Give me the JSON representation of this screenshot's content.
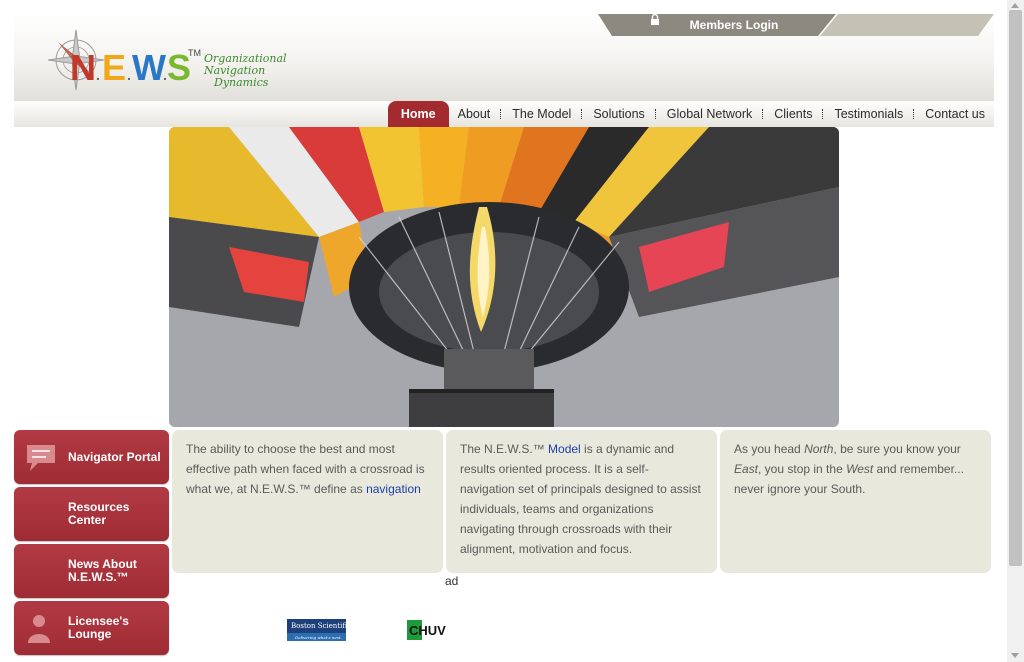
{
  "header": {
    "logo_main": "N.E.W.S",
    "logo_tm": "TM",
    "logo_tagline": [
      "Organizational",
      "Navigation",
      "Dynamics"
    ],
    "members_login": "Members Login"
  },
  "nav": {
    "items": [
      {
        "label": "Home",
        "active": true
      },
      {
        "label": "About"
      },
      {
        "label": "The Model"
      },
      {
        "label": "Solutions"
      },
      {
        "label": "Global Network"
      },
      {
        "label": "Clients"
      },
      {
        "label": "Testimonials"
      },
      {
        "label": "Contact us"
      }
    ]
  },
  "sidebar": {
    "items": [
      {
        "label": "Navigator Portal",
        "icon": "speech-bubble-icon"
      },
      {
        "label": "Resources Center",
        "icon": ""
      },
      {
        "label": "News About N.E.W.S.™",
        "icon": ""
      },
      {
        "label": "Licensee's Lounge",
        "icon": "person-icon"
      }
    ]
  },
  "panels": {
    "p1": {
      "text": "The ability to choose the best and most effective path when faced with a crossroad is what we, at N.E.W.S.™ define as ",
      "link": "navigation"
    },
    "p2": {
      "before": "The N.E.W.S.™ ",
      "link": "Model",
      "after": " is a dynamic and results oriented process. It is a self-navigation set of principals designed to assist individuals, teams and organizations navigating through crossroads with their alignment, motivation and focus."
    },
    "p3": {
      "t1": "As you head ",
      "north": "North",
      "t2": ", be sure you know your ",
      "east": "East",
      "t3": ", you stop in the ",
      "west": "West",
      "t4": " and remember... never ignore your South."
    }
  },
  "footer": {
    "ad": "ad",
    "client_logos": [
      "Boston Scientific",
      "CHUV"
    ],
    "client_tagline": "Delivering what's next."
  },
  "colors": {
    "accent": "#a32a2f",
    "panel": "#e9e8dc",
    "link": "#1b3fa8",
    "header_tab": "#8c8a80"
  }
}
